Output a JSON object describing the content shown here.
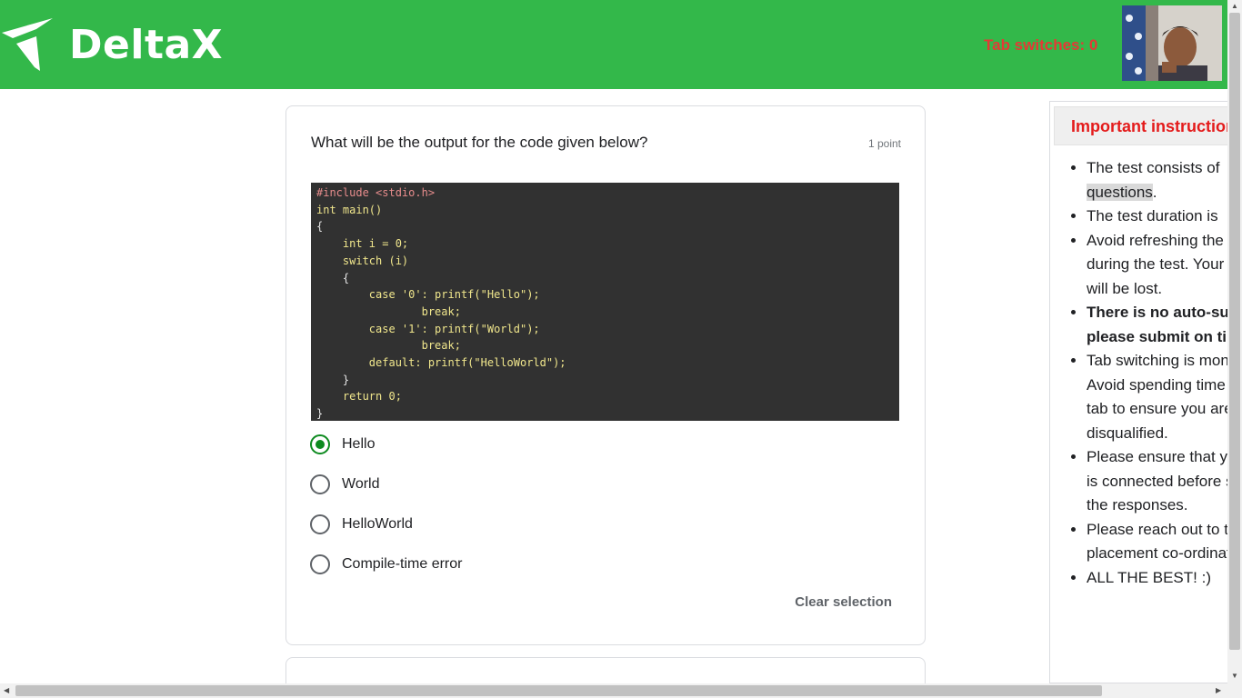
{
  "header": {
    "logo_text": "DeltaX",
    "tab_switches": "Tab switches: 0",
    "brand_color": "#33b84a",
    "warning_color": "#e53935"
  },
  "question": {
    "text": "What will be the output for the code given below?",
    "points": "1 point",
    "code_lines": [
      "#include <stdio.h>",
      "int main()",
      "{",
      "    int i = 0;",
      "    switch (i)",
      "    {",
      "        case '0': printf(\"Hello\");",
      "                break;",
      "        case '1': printf(\"World\");",
      "                break;",
      "        default: printf(\"HelloWorld\");",
      "    }",
      "    return 0;",
      "}"
    ],
    "options": [
      {
        "label": "Hello",
        "selected": true
      },
      {
        "label": "World",
        "selected": false
      },
      {
        "label": "HelloWorld",
        "selected": false
      },
      {
        "label": "Compile-time error",
        "selected": false
      }
    ],
    "clear_selection": "Clear selection"
  },
  "instructions": {
    "title": "Important instructions",
    "items": [
      {
        "text": "The test consists of ",
        "line2": "questions",
        "line2_suffix": "."
      },
      {
        "text": "The test duration is"
      },
      {
        "text": "Avoid refreshing the page",
        "line2": "during the test. Your responses",
        "line3": "will be lost."
      },
      {
        "text": "There is no auto-submit,",
        "line2": "please submit on time.",
        "bold": true
      },
      {
        "text": "Tab switching is monitored.",
        "line2": "Avoid spending time on another",
        "line3": "tab to ensure you are not",
        "line4": "disqualified."
      },
      {
        "text": "Please ensure that your internet",
        "line2": "is connected before submitting",
        "line3": "the responses."
      },
      {
        "text": "Please reach out to the",
        "line2": "placement co-ordinators."
      },
      {
        "text": "ALL THE BEST! :)"
      }
    ]
  }
}
